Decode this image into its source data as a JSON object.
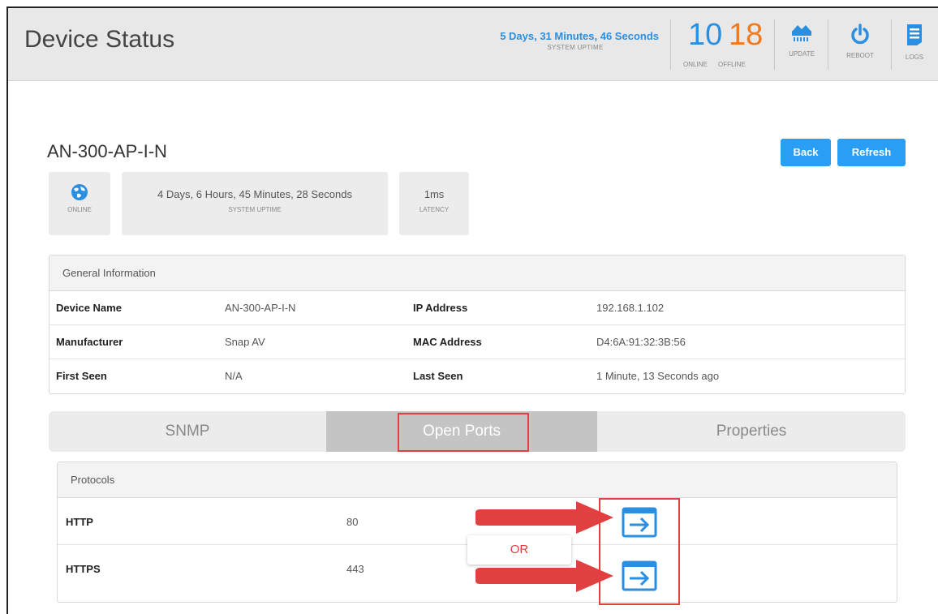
{
  "header": {
    "title": "Device Status",
    "uptime_value": "5 Days, 31 Minutes, 46 Seconds",
    "uptime_label": "SYSTEM UPTIME",
    "online_count": "10",
    "offline_count": "18",
    "online_label": "ONLINE",
    "offline_label": "OFFLINE",
    "buttons": [
      {
        "label": "UPDATE",
        "icon": "update-icon"
      },
      {
        "label": "REBOOT",
        "icon": "power-icon"
      },
      {
        "label": "LOGS",
        "icon": "logs-icon"
      }
    ]
  },
  "device": {
    "name": "AN-300-AP-I-N",
    "back_label": "Back",
    "refresh_label": "Refresh",
    "status_label": "ONLINE",
    "uptime_value": "4 Days, 6 Hours, 45 Minutes, 28 Seconds",
    "uptime_label": "SYSTEM UPTIME",
    "latency_value": "1ms",
    "latency_label": "LATENCY"
  },
  "general": {
    "heading": "General Information",
    "rows": [
      {
        "k1": "Device Name",
        "v1": "AN-300-AP-I-N",
        "k2": "IP Address",
        "v2": "192.168.1.102"
      },
      {
        "k1": "Manufacturer",
        "v1": "Snap AV",
        "k2": "MAC Address",
        "v2": "D4:6A:91:32:3B:56"
      },
      {
        "k1": "First Seen",
        "v1": "N/A",
        "k2": "Last Seen",
        "v2": "1 Minute, 13 Seconds ago"
      }
    ]
  },
  "tabs": {
    "snmp": "SNMP",
    "ports": "Open Ports",
    "properties": "Properties",
    "active": "Open Ports"
  },
  "protocols": {
    "heading": "Protocols",
    "rows": [
      {
        "name": "HTTP",
        "port": "80"
      },
      {
        "name": "HTTPS",
        "port": "443"
      }
    ]
  },
  "annotation": {
    "or_label": "OR"
  },
  "colors": {
    "accent": "#2a9df4",
    "online": "#2a8fe0",
    "offline": "#f07a1e",
    "highlight": "#e04040"
  }
}
